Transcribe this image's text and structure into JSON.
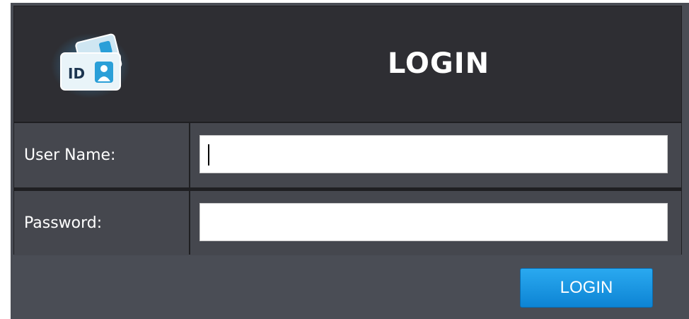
{
  "header": {
    "title": "LOGIN",
    "logo_icon": "id-card-icon",
    "logo_text": "ID"
  },
  "form": {
    "username_label": "User Name:",
    "username_value": "",
    "password_label": "Password:",
    "password_value": ""
  },
  "actions": {
    "login_label": "LOGIN"
  },
  "colors": {
    "panel_bg": "#4a4d55",
    "header_bg": "#2e2e33",
    "button_accent": "#1a96e2"
  }
}
